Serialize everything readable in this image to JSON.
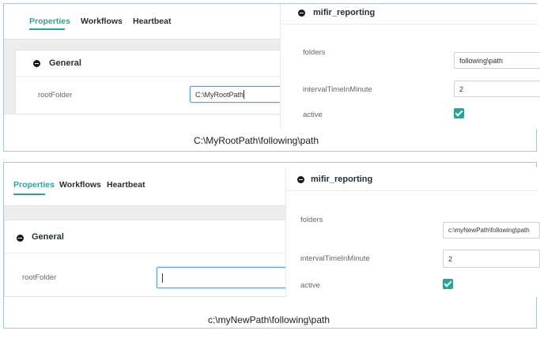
{
  "panels": [
    {
      "tabs": [
        "Properties",
        "Workflows",
        "Heartbeat"
      ],
      "active_tab": 0,
      "general": {
        "title": "General",
        "root_folder_label": "rootFolder",
        "root_folder_value": "C:\\MyRootPath"
      },
      "reporting": {
        "title": "mifir_reporting",
        "folders_label": "folders",
        "folders_value": "following\\path",
        "interval_label": "intervalTimeInMinute",
        "interval_value": "2",
        "active_label": "active",
        "active_checked": true
      },
      "caption": "C:\\MyRootPath\\following\\path"
    },
    {
      "tabs": [
        "Properties",
        "Workflows",
        "Heartbeat"
      ],
      "active_tab": 0,
      "general": {
        "title": "General",
        "root_folder_label": "rootFolder",
        "root_folder_value": ""
      },
      "reporting": {
        "title": "mifir_reporting",
        "folders_label": "folders",
        "folders_value": "c:\\myNewPath\\following\\path",
        "interval_label": "intervalTimeInMinute",
        "interval_value": "2",
        "active_label": "active",
        "active_checked": true
      },
      "caption": "c:\\myNewPath\\following\\path"
    }
  ],
  "colors": {
    "accent": "#26a69a",
    "frame": "#a8c7dd",
    "focus": "#5aa0d8"
  },
  "icons": [
    "minus-circle-icon",
    "checkmark-icon"
  ]
}
